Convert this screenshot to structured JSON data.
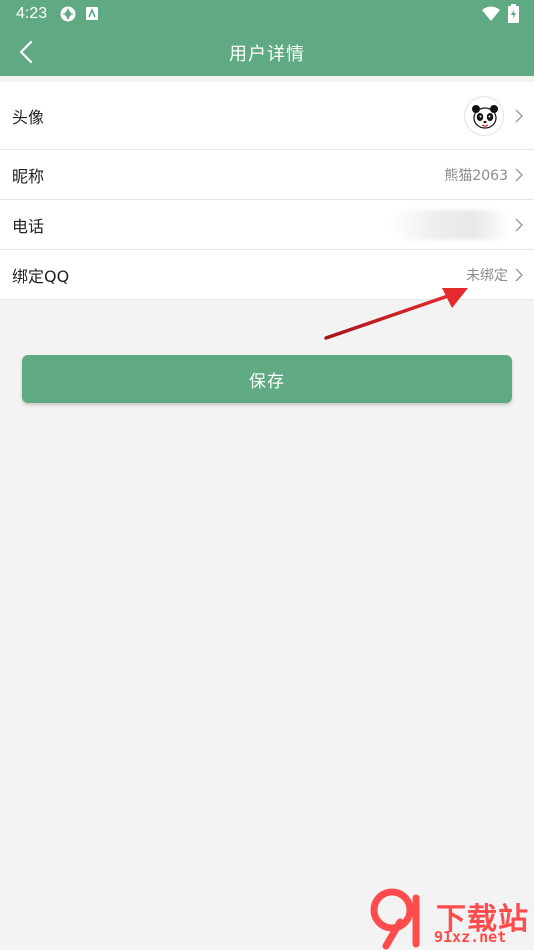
{
  "status_bar": {
    "time": "4:23"
  },
  "nav": {
    "title": "用户详情"
  },
  "rows": [
    {
      "label": "头像",
      "value": ""
    },
    {
      "label": "昵称",
      "value": "熊猫2063"
    },
    {
      "label": "电话",
      "value": ""
    },
    {
      "label": "绑定QQ",
      "value": "未绑定"
    }
  ],
  "save_label": "保存",
  "colors": {
    "primary": "#5faa83",
    "background": "#f3f3f3",
    "annotation_arrow": "#d9252a"
  },
  "icons": {
    "back": "chevron-left-icon",
    "row_arrow": "chevron-right-icon"
  },
  "watermark": {
    "brand": "下载站",
    "url": "91xz.net"
  }
}
